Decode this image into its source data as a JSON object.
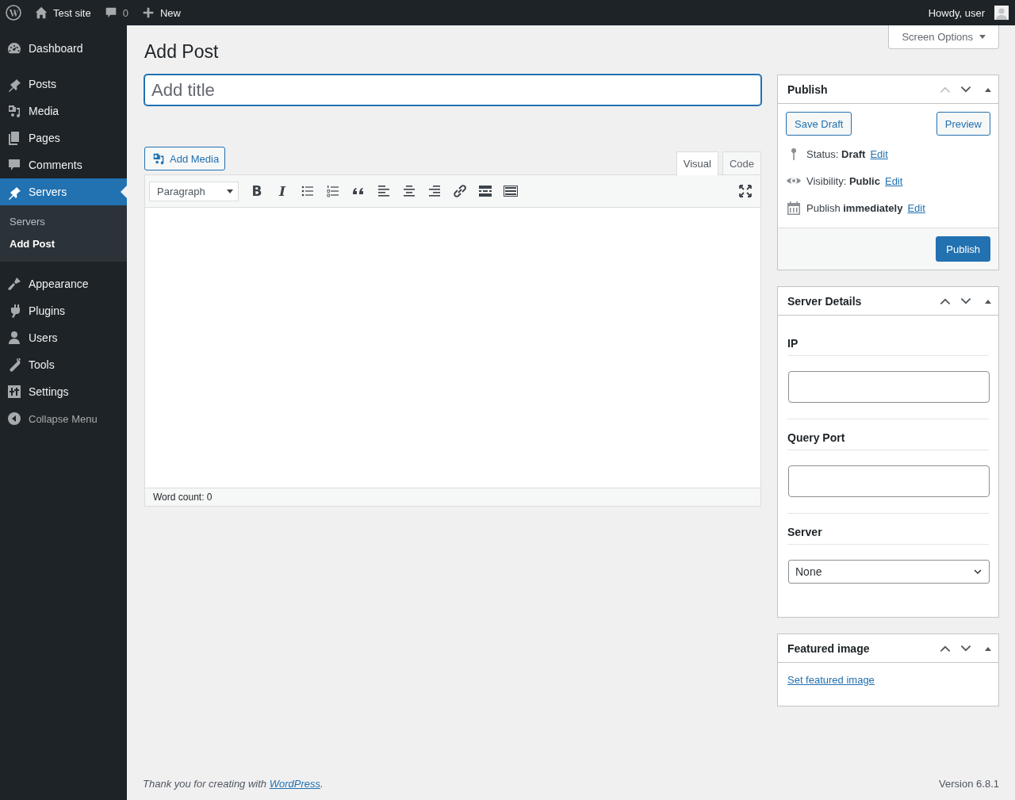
{
  "admin_bar": {
    "site": "Test site",
    "comments": "0",
    "new": "New",
    "greeting": "Howdy, user"
  },
  "sidebar": {
    "items": [
      {
        "label": "Dashboard",
        "selected": false
      },
      {
        "label": "Posts",
        "selected": false
      },
      {
        "label": "Media",
        "selected": false
      },
      {
        "label": "Pages",
        "selected": false
      },
      {
        "label": "Comments",
        "selected": false
      },
      {
        "label": "Servers",
        "selected": true,
        "children": [
          {
            "label": "Servers",
            "selected": false
          },
          {
            "label": "Add Post",
            "selected": true
          }
        ]
      },
      {
        "label": "Appearance",
        "selected": false
      },
      {
        "label": "Plugins",
        "selected": false
      },
      {
        "label": "Users",
        "selected": false
      },
      {
        "label": "Tools",
        "selected": false
      },
      {
        "label": "Settings",
        "selected": false
      }
    ],
    "collapse": "Collapse Menu"
  },
  "screen_options": "Screen Options",
  "page_title": "Add Post",
  "title_field": {
    "placeholder": "Add title"
  },
  "editor": {
    "add_media": "Add Media",
    "tabs": [
      {
        "label": "Visual",
        "selected": true
      },
      {
        "label": "Code",
        "selected": false
      }
    ],
    "format": "Paragraph",
    "toolbar": [
      {
        "kind": "bold",
        "glyph": "B"
      },
      {
        "kind": "italic",
        "glyph": "I"
      },
      {
        "kind": "bullist"
      },
      {
        "kind": "numlist"
      },
      {
        "kind": "quote"
      },
      {
        "kind": "alignleft"
      },
      {
        "kind": "aligncenter"
      },
      {
        "kind": "alignright"
      },
      {
        "kind": "link"
      },
      {
        "kind": "more"
      },
      {
        "kind": "kitchensink"
      }
    ],
    "word_count": "Word count: 0"
  },
  "publish": {
    "title": "Publish",
    "up_disabled": true,
    "save_draft": "Save Draft",
    "preview": "Preview",
    "meta": [
      {
        "kind": "status",
        "text": "Status: **Draft**",
        "link": "Edit"
      },
      {
        "kind": "visibility",
        "text": "Visibility: **Public**",
        "link": "Edit"
      },
      {
        "kind": "schedule",
        "text": "Publish **immediately**",
        "link": "Edit"
      }
    ],
    "button": "Publish"
  },
  "server_details": {
    "title": "Server Details",
    "up_disabled": false,
    "fields": [
      {
        "kind": "text",
        "label": "IP"
      },
      {
        "kind": "text",
        "label": "Query Port"
      },
      {
        "kind": "select",
        "label": "Server",
        "value": "None"
      }
    ]
  },
  "featured_image": {
    "title": "Featured image",
    "up_disabled": false,
    "link": "Set featured image"
  },
  "footer": {
    "before": "Thank you for creating with ",
    "link": "WordPress",
    "after": ".",
    "version": "Version 6.8.1"
  }
}
